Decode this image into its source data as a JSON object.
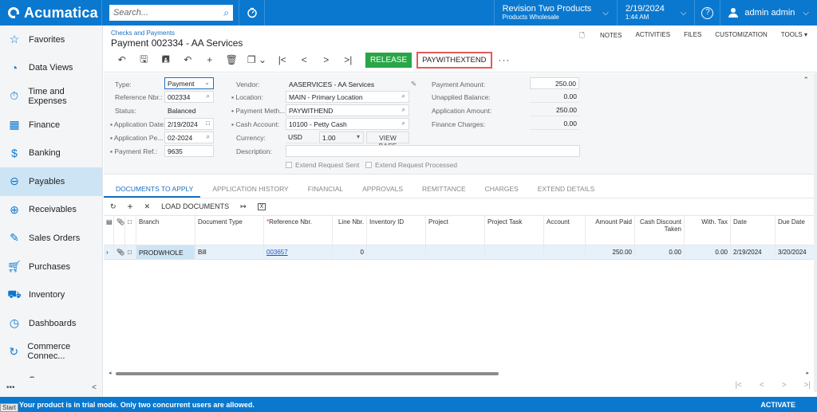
{
  "topbar": {
    "brand": "Acumatica",
    "search_placeholder": "Search...",
    "company": "Revision Two Products",
    "branch": "Products Wholesale",
    "date": "2/19/2024",
    "time": "1:44 AM",
    "user": "admin admin",
    "colors": {
      "brand": "#0a78cf"
    }
  },
  "sidebar": {
    "items": [
      {
        "label": "Favorites",
        "icon": "star-icon"
      },
      {
        "label": "Data Views",
        "icon": "pie-chart-icon"
      },
      {
        "label": "Time and Expenses",
        "icon": "stopwatch-icon"
      },
      {
        "label": "Finance",
        "icon": "calculator-icon"
      },
      {
        "label": "Banking",
        "icon": "dollar-icon"
      },
      {
        "label": "Payables",
        "icon": "minus-circle-icon",
        "active": true
      },
      {
        "label": "Receivables",
        "icon": "plus-circle-icon"
      },
      {
        "label": "Sales Orders",
        "icon": "pencil-square-icon"
      },
      {
        "label": "Purchases",
        "icon": "cart-icon"
      },
      {
        "label": "Inventory",
        "icon": "truck-icon"
      },
      {
        "label": "Dashboards",
        "icon": "gauge-icon"
      },
      {
        "label": "Commerce Connec...",
        "icon": "sync-icon"
      },
      {
        "label": "Commerce",
        "icon": "basket-icon"
      }
    ],
    "more": "•••",
    "collapse": "<"
  },
  "header": {
    "breadcrumb": "Checks and Payments",
    "title": "Payment 002334 - AA Services",
    "links": [
      "NOTES",
      "ACTIVITIES",
      "FILES",
      "CUSTOMIZATION",
      "TOOLS ▾"
    ]
  },
  "toolbar": {
    "release": "RELEASE",
    "paywithextend": "PAYWITHEXTEND",
    "more": "···"
  },
  "form": {
    "type_label": "Type:",
    "type_value": "Payment",
    "refnbr_label": "Reference Nbr.:",
    "refnbr_value": "002334",
    "status_label": "Status:",
    "status_value": "Balanced",
    "appdate_label": "Application Date:",
    "appdate_value": "2/19/2024",
    "appperiod_label": "Application Pe...",
    "appperiod_value": "02-2024",
    "payref_label": "Payment Ref.:",
    "payref_value": "9635",
    "vendor_label": "Vendor:",
    "vendor_value": "AASERVICES - AA Services",
    "location_label": "Location:",
    "location_value": "MAIN - Primary Location",
    "paymethod_label": "Payment Meth...",
    "paymethod_value": "PAYWITHEND",
    "cashacct_label": "Cash Account:",
    "cashacct_value": "10100 - Petty Cash",
    "currency_label": "Currency:",
    "currency_value": "USD",
    "rate_value": "1.00",
    "viewbase": "VIEW BASE",
    "description_label": "Description:",
    "description_value": "",
    "extend_sent": "Extend Request Sent",
    "extend_processed": "Extend Request Processed",
    "payamt_label": "Payment Amount:",
    "payamt_value": "250.00",
    "unapplied_label": "Unapplied Balance:",
    "unapplied_value": "0.00",
    "appamt_label": "Application Amount:",
    "appamt_value": "250.00",
    "fincharges_label": "Finance Charges:",
    "fincharges_value": "0.00"
  },
  "tabs": [
    "DOCUMENTS TO APPLY",
    "APPLICATION HISTORY",
    "FINANCIAL",
    "APPROVALS",
    "REMITTANCE",
    "CHARGES",
    "EXTEND DETAILS"
  ],
  "grid_toolbar": {
    "load_documents": "LOAD DOCUMENTS"
  },
  "grid": {
    "columns": [
      "Branch",
      "Document Type",
      "Reference Nbr.",
      "Line Nbr.",
      "Inventory ID",
      "Project",
      "Project Task",
      "Account",
      "Amount Paid",
      "Cash Discount Taken",
      "With. Tax",
      "Date",
      "Due Date"
    ],
    "rows": [
      {
        "branch": "PRODWHOLE",
        "doctype": "Bill",
        "refnbr": "003657",
        "linenbr": "0",
        "inventory": "",
        "project": "",
        "task": "",
        "account": "",
        "amountpaid": "250.00",
        "cashdisc": "0.00",
        "withtax": "0.00",
        "date": "2/19/2024",
        "duedate": "3/20/2024"
      }
    ]
  },
  "banner": {
    "message": "Your product is in trial mode. Only two concurrent users are allowed.",
    "action": "ACTIVATE",
    "start": "Start"
  }
}
